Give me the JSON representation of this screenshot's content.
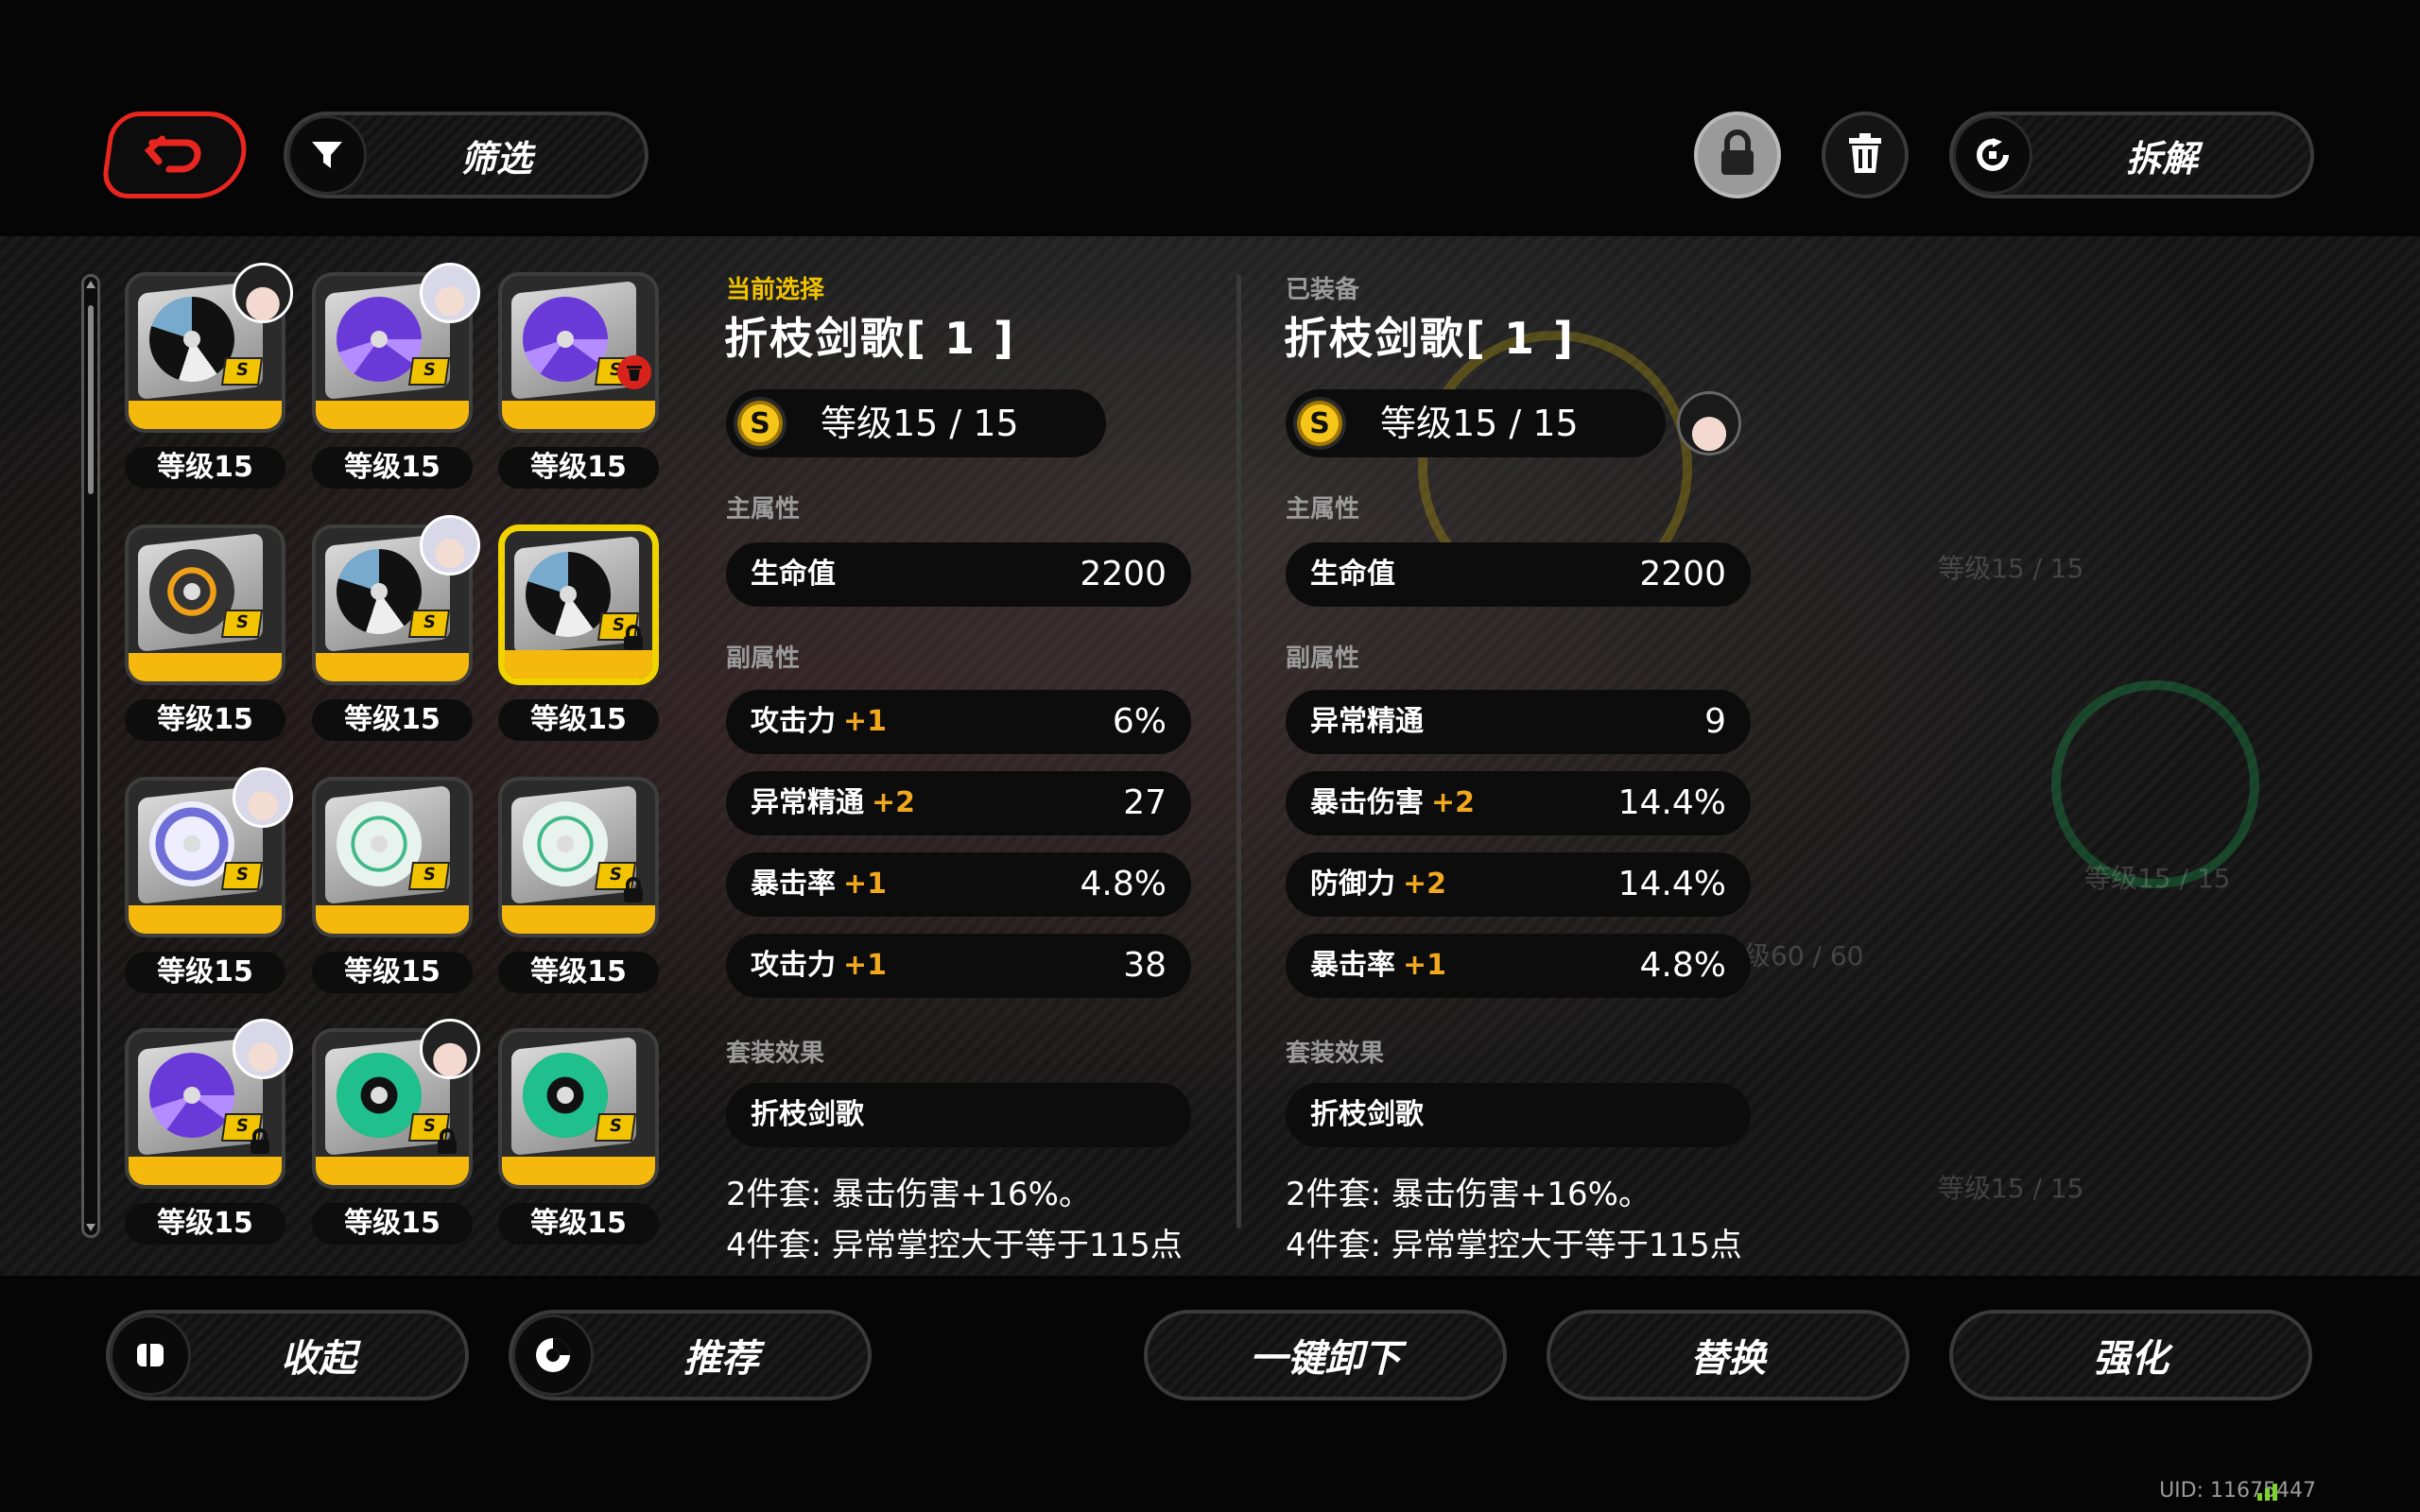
{
  "top": {
    "filter_label": "筛选",
    "dismantle_label": "拆解",
    "icons": [
      "back-arrow-icon",
      "filter-icon",
      "lock-icon",
      "trash-icon",
      "dismantle-icon"
    ]
  },
  "discs": [
    {
      "level": "等级15",
      "avatar": "dark",
      "style": "black-white"
    },
    {
      "level": "等级15",
      "avatar": "white",
      "style": "purple"
    },
    {
      "level": "等级15",
      "trash": true,
      "style": "purple"
    },
    {
      "level": "等级15",
      "style": "orange"
    },
    {
      "level": "等级15",
      "avatar": "white",
      "style": "black-white"
    },
    {
      "level": "等级15",
      "selected": true,
      "locked": true,
      "style": "black-white"
    },
    {
      "level": "等级15",
      "avatar": "white",
      "style": "blue-white"
    },
    {
      "level": "等级15",
      "style": "green-white"
    },
    {
      "level": "等级15",
      "locked": true,
      "style": "green-white"
    },
    {
      "level": "等级15",
      "avatar": "white",
      "locked": true,
      "style": "purple"
    },
    {
      "level": "等级15",
      "avatar": "dark",
      "locked": true,
      "style": "green"
    },
    {
      "level": "等级15",
      "style": "green"
    }
  ],
  "current": {
    "label": "当前选择",
    "title": "折枝剑歌[ 1 ]",
    "rank": "S",
    "level": "等级15 / 15",
    "main_label": "主属性",
    "main": {
      "name": "生命值",
      "value": "2200"
    },
    "sub_label": "副属性",
    "subs": [
      {
        "name": "攻击力",
        "plus": "+1",
        "value": "6%"
      },
      {
        "name": "异常精通",
        "plus": "+2",
        "value": "27"
      },
      {
        "name": "暴击率",
        "plus": "+1",
        "value": "4.8%"
      },
      {
        "name": "攻击力",
        "plus": "+1",
        "value": "38"
      }
    ],
    "set_label": "套装效果",
    "set_name": "折枝剑歌",
    "effect2": "2件套: 暴击伤害+16%。",
    "effect4": "4件套: 异常掌控大于等于115点"
  },
  "equipped": {
    "label": "已装备",
    "title": "折枝剑歌[ 1 ]",
    "rank": "S",
    "level": "等级15 / 15",
    "main_label": "主属性",
    "main": {
      "name": "生命值",
      "value": "2200"
    },
    "sub_label": "副属性",
    "subs": [
      {
        "name": "异常精通",
        "plus": "",
        "value": "9"
      },
      {
        "name": "暴击伤害",
        "plus": "+2",
        "value": "14.4%"
      },
      {
        "name": "防御力",
        "plus": "+2",
        "value": "14.4%"
      },
      {
        "name": "暴击率",
        "plus": "+1",
        "value": "4.8%"
      }
    ],
    "set_label": "套装效果",
    "set_name": "折枝剑歌",
    "effect2": "2件套: 暴击伤害+16%。",
    "effect4": "4件套: 异常掌控大于等于115点"
  },
  "background": {
    "ghost_level_a": "等级15 / 15",
    "ghost_level_b": "等级15 / 15",
    "ghost_level_c": "等级15 / 15",
    "ghost_level_d": "级60 / 60"
  },
  "bottom": {
    "collapse_label": "收起",
    "recommend_label": "推荐",
    "unequip_all_label": "一键卸下",
    "replace_label": "替换",
    "enhance_label": "强化"
  },
  "uid": "UID: 11675447",
  "colors": {
    "accent": "#f2c400",
    "plus": "#f2a81c",
    "back": "#e8261f",
    "disc_bar": "#f5b80d"
  }
}
